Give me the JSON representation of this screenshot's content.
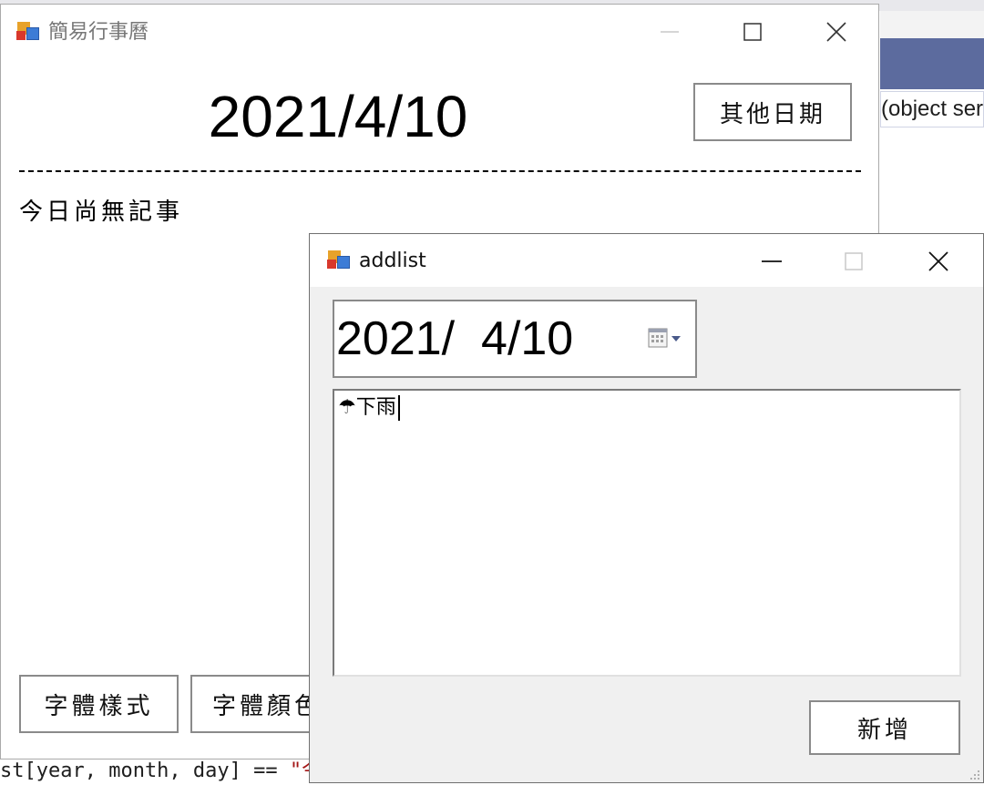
{
  "background": {
    "code_snippet_right": "(object ser",
    "code_snippet_bottom_prefix": "st[year, month, day] == ",
    "code_snippet_bottom_string": "\"今"
  },
  "main_window": {
    "title": "簡易行事曆",
    "date": "2021/4/10",
    "other_date_button": "其他日期",
    "no_events_text": "今日尚無記事",
    "font_style_button": "字體樣式",
    "font_color_button": "字體顏色"
  },
  "addlist_window": {
    "title": "addlist",
    "date_value": "2021/  4/10",
    "note_value": "☂下雨",
    "add_button": "新增"
  },
  "colors": {
    "ide_tab": "#5c6b9e",
    "string_literal": "#a31515"
  }
}
